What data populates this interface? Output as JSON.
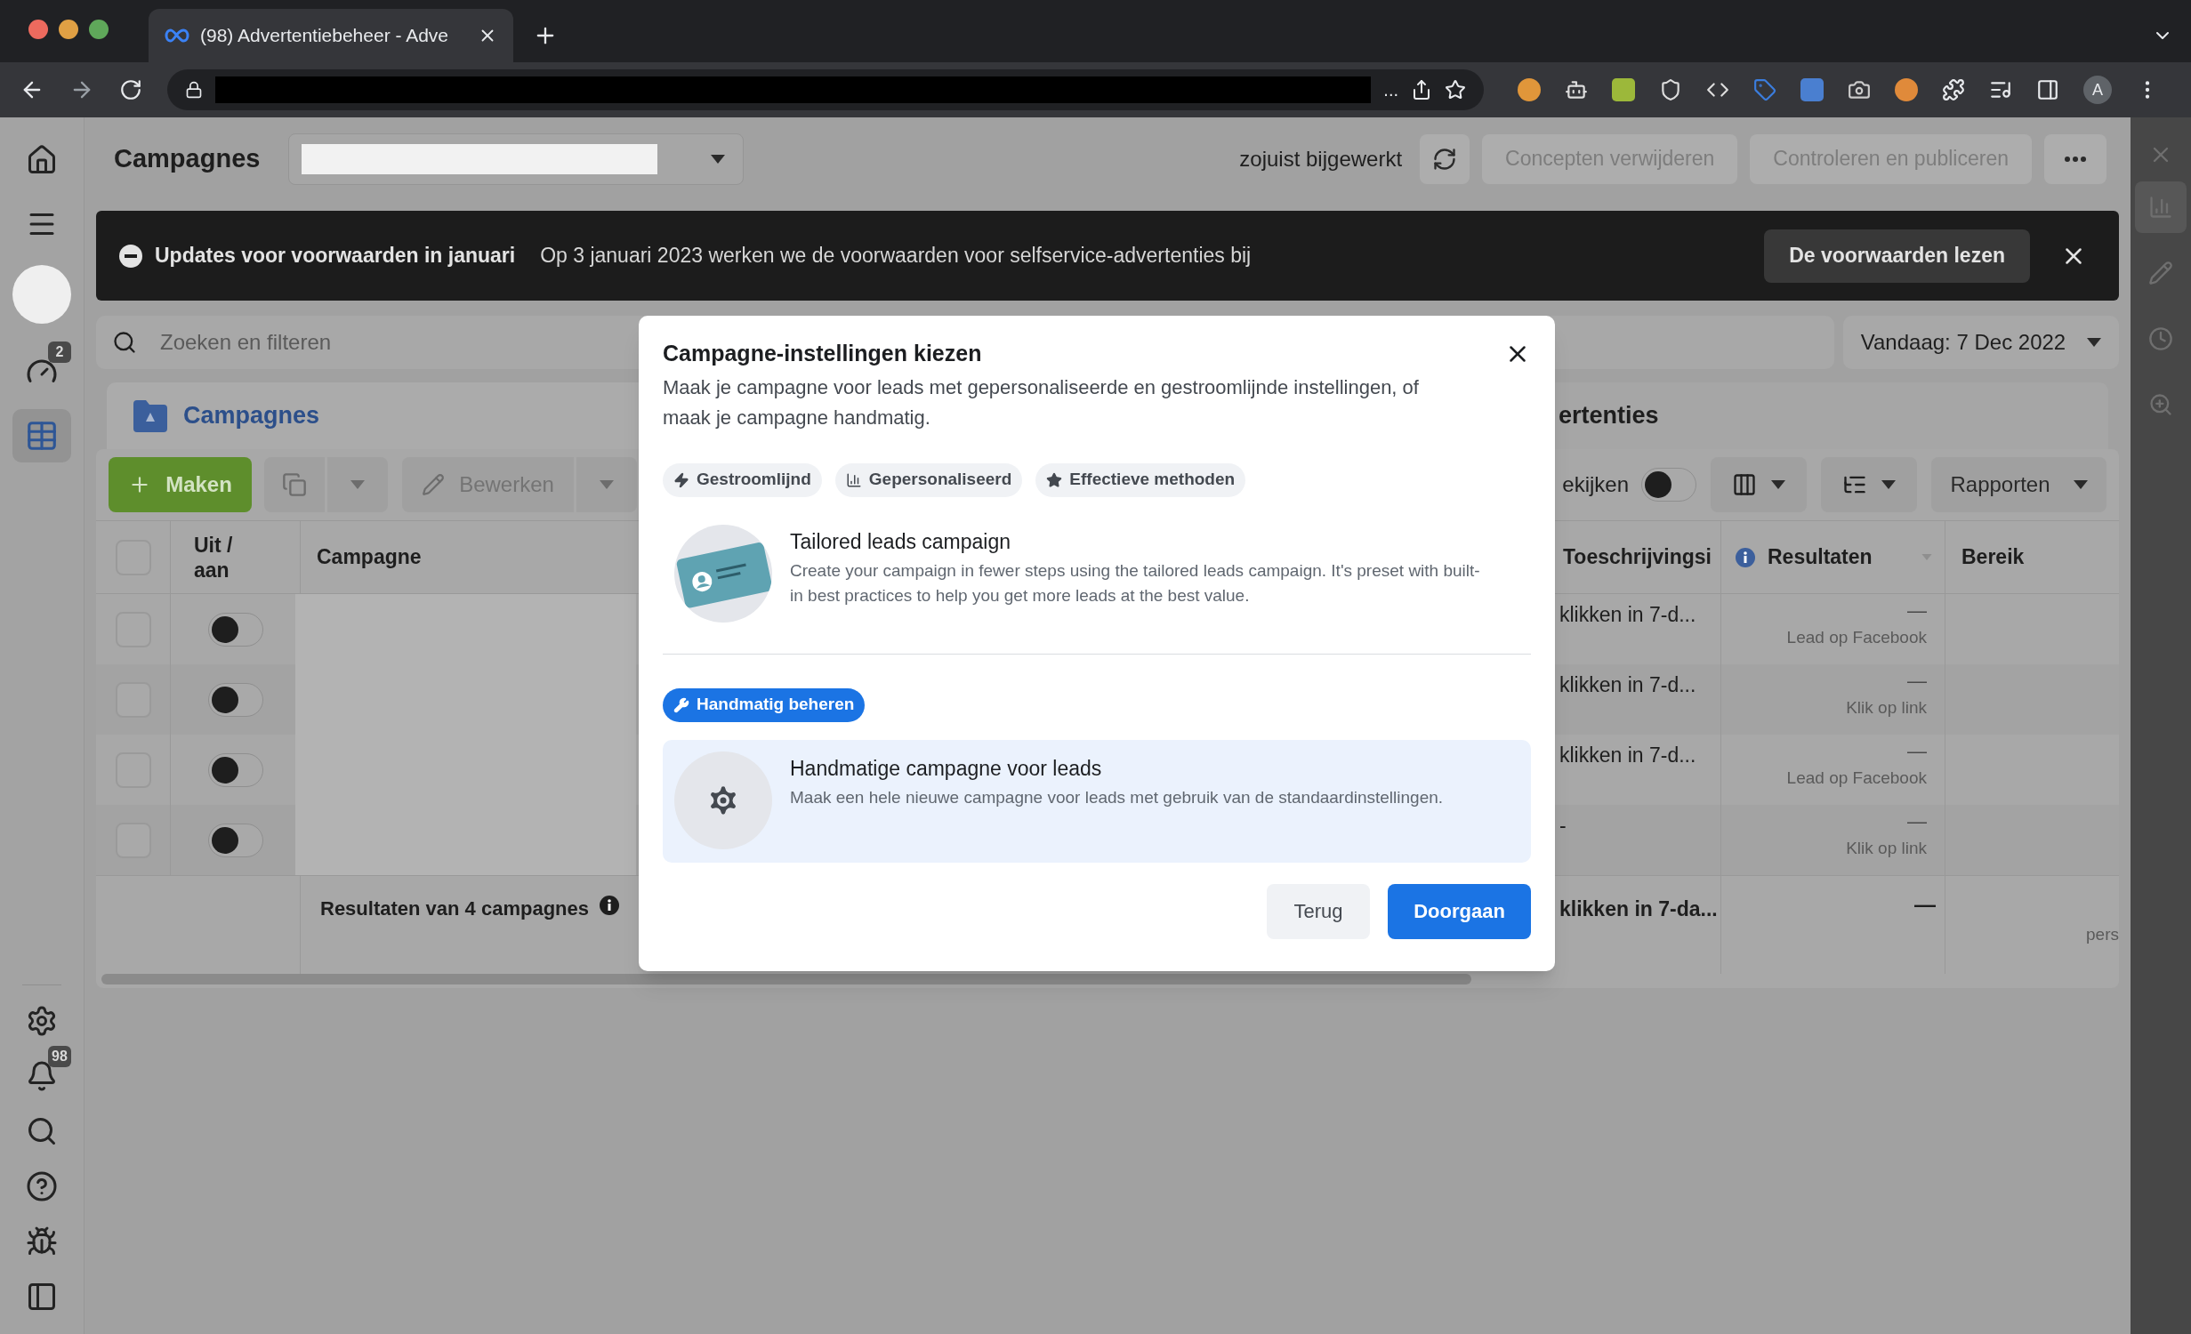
{
  "browser": {
    "tab_title": "(98) Advertentiebeheer - Adve",
    "url_overflow": "...",
    "profile_initial": "A"
  },
  "left_nav": {
    "top_items": [
      {
        "selected": false
      },
      {
        "selected": false
      },
      {
        "selected": false,
        "badge": "2"
      },
      {
        "selected": true
      }
    ],
    "bottom_items": [
      {
        "selected": false
      },
      {
        "selected": false,
        "badge": "98"
      },
      {
        "selected": false
      },
      {
        "selected": false
      },
      {
        "selected": false
      },
      {
        "selected": false
      }
    ]
  },
  "right_rail": {
    "items": [
      {
        "selected": true
      },
      {
        "selected": false
      },
      {
        "selected": false
      },
      {
        "selected": false
      }
    ]
  },
  "header": {
    "title": "Campagnes",
    "status": "zojuist bijgewerkt",
    "buttons": [
      {
        "label": "Concepten verwijderen",
        "disabled": true
      },
      {
        "label": "Controleren en publiceren",
        "disabled": true
      }
    ]
  },
  "banner": {
    "title": "Updates voor voorwaarden in januari",
    "text": "Op 3 januari 2023 werken we de voorwaarden voor selfservice-advertenties bij",
    "action": "De voorwaarden lezen"
  },
  "search": {
    "placeholder": "Zoeken en filteren"
  },
  "date_range": "Vandaag: 7 Dec 2022",
  "level_tabs": [
    {
      "label": "Campagnes",
      "selected": true
    },
    {
      "label": "ertenties",
      "selected": false
    }
  ],
  "toolbar": {
    "create": "Maken",
    "edit": "Bewerken",
    "view_toggle": {
      "label": "ekijken",
      "on": false
    },
    "reports": "Rapporten"
  },
  "table": {
    "all_checked": false,
    "columns": [
      "Uit / aan",
      "Campagne",
      "Toeschrijvingsi",
      "Resultaten",
      "Bereik"
    ],
    "rows": [
      {
        "checked": false,
        "on": false,
        "attribution": "klikken in 7-d...",
        "results": "—",
        "result_type": "Lead op Facebook"
      },
      {
        "checked": false,
        "on": false,
        "attribution": "klikken in 7-d...",
        "results": "—",
        "result_type": "Klik op link"
      },
      {
        "checked": false,
        "on": false,
        "attribution": "klikken in 7-d...",
        "results": "—",
        "result_type": "Lead op Facebook"
      },
      {
        "checked": false,
        "on": false,
        "attribution": "-",
        "results": "—",
        "result_type": "Klik op link"
      }
    ],
    "summary": {
      "label": "Resultaten van 4 campagnes",
      "attribution": "klikken in 7-da...",
      "results": "—",
      "reach": "pers"
    }
  },
  "dialog": {
    "title": "Campagne-instellingen kiezen",
    "subtitle": "Maak je campagne voor leads met gepersonaliseerde en gestroomlijnde instellingen, of maak je campagne handmatig.",
    "tags": [
      "Gestroomlijnd",
      "Gepersonaliseerd",
      "Effectieve methoden"
    ],
    "options": [
      {
        "title": "Tailored leads campaign",
        "description": "Create your campaign in fewer steps using the tailored leads campaign. It's preset with built-in best practices to help you get more leads at the best value.",
        "selected": false
      },
      {
        "badge": "Handmatig beheren",
        "title": "Handmatige campagne voor leads",
        "description": "Maak een hele nieuwe campagne voor leads met gebruik van de standaardinstellingen.",
        "selected": true
      }
    ],
    "buttons": [
      {
        "label": "Terug",
        "kind": "secondary"
      },
      {
        "label": "Doorgaan",
        "kind": "primary"
      }
    ]
  }
}
